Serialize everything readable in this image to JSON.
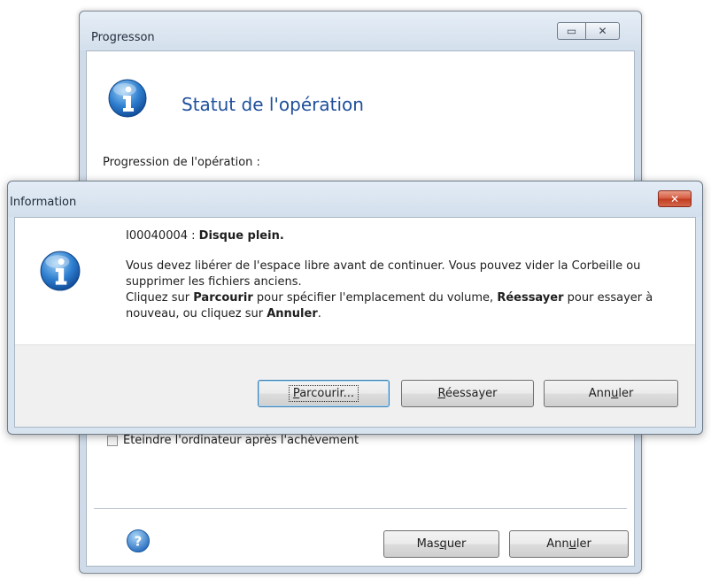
{
  "background_window": {
    "title": "Progresson",
    "minimize_glyph": "▭",
    "close_glyph": "✕",
    "heading": "Statut de l'opération",
    "progress_label": "Progression de l'opération :",
    "checkbox_label": "Eteindre l'ordinateur après l'achèvement",
    "buttons": {
      "hide_pre": "Mas",
      "hide_key": "q",
      "hide_post": "uer",
      "cancel_pre": "Ann",
      "cancel_key": "u",
      "cancel_post": "ler"
    },
    "icons": [
      "info-icon",
      "help-icon"
    ]
  },
  "dialog": {
    "title": "Information",
    "close_glyph": "✕",
    "code": "I00040004 : ",
    "code_bold": "Disque plein.",
    "paragraph1": "Vous devez libérer de l'espace libre avant de continuer. Vous pouvez vider la Corbeille ou supprimer les fichiers anciens.",
    "p2_a": "Cliquez sur ",
    "p2_b": "Parcourir",
    "p2_c": " pour spécifier l'emplacement du volume, ",
    "p2_d": "Réessayer",
    "p2_e": " pour essayer à nouveau, ou cliquez sur ",
    "p2_f": "Annuler",
    "p2_g": ".",
    "buttons": {
      "browse_key": "P",
      "browse_post": "arcourir...",
      "retry_key": "R",
      "retry_post": "éessayer",
      "cancel_pre": "Ann",
      "cancel_key": "u",
      "cancel_post": "ler"
    },
    "icon": "info-icon"
  }
}
